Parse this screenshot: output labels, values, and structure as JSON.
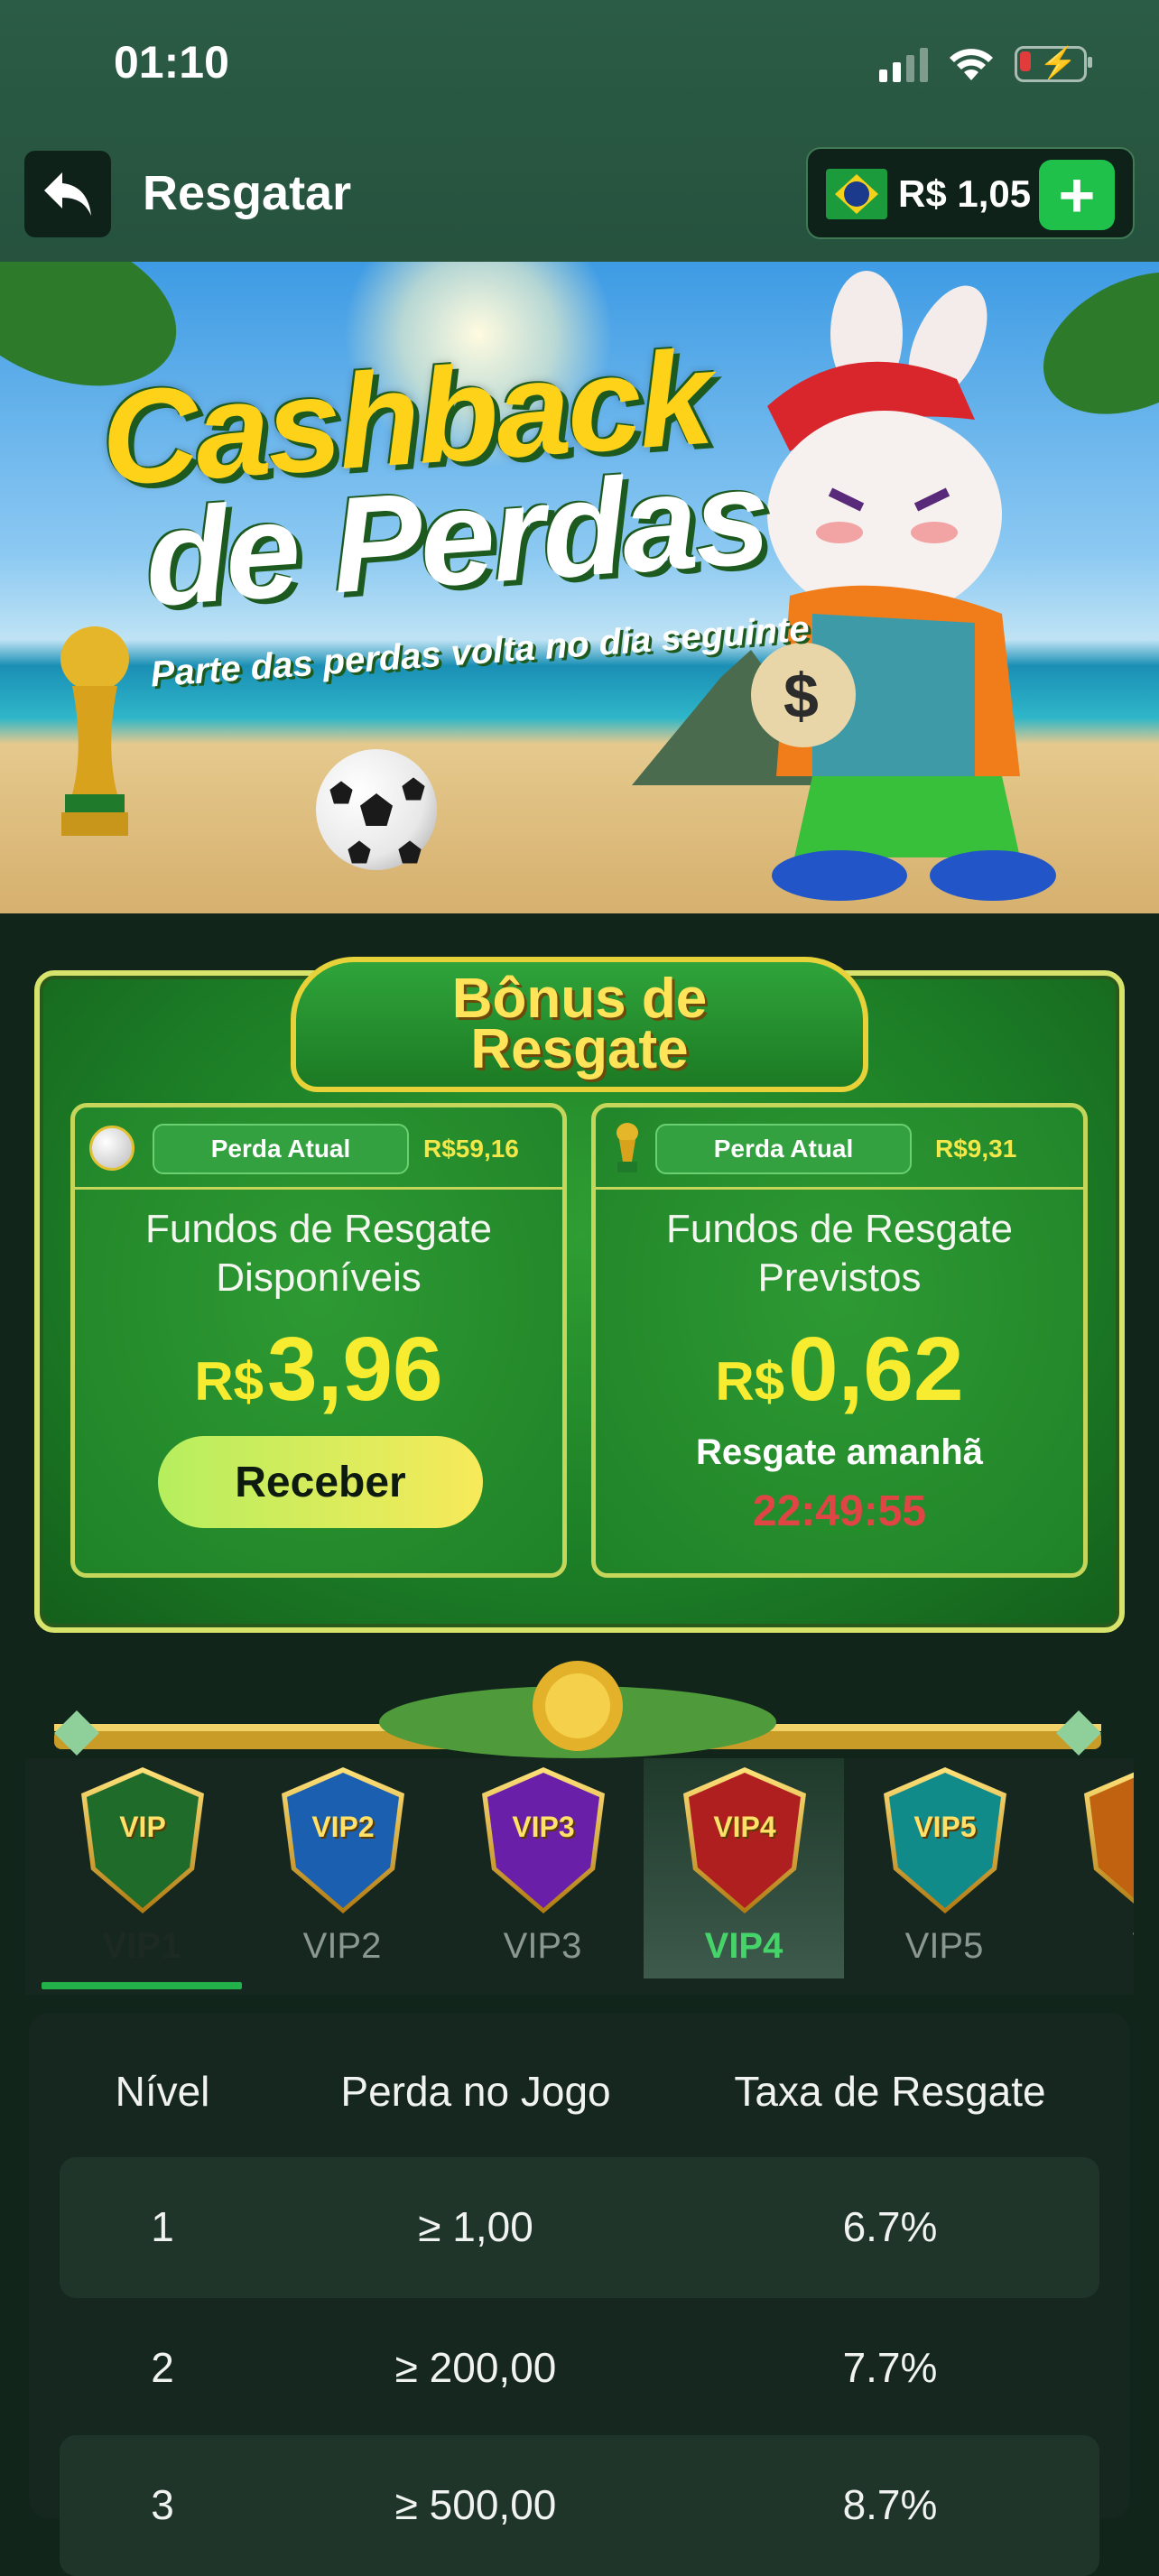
{
  "status_bar": {
    "time": "01:10"
  },
  "header": {
    "title": "Resgatar",
    "balance": "R$ 1,05",
    "add_label": "+"
  },
  "banner": {
    "title_line1": "Cashback",
    "title_line2": "de Perdas",
    "subtitle": "Parte das perdas volta no dia seguinte"
  },
  "bonus": {
    "title_line1": "Bônus de",
    "title_line2": "Resgate",
    "available": {
      "chip_label": "Perda Atual",
      "loss_amount": "R$59,16",
      "label_line1": "Fundos de Resgate",
      "label_line2": "Disponíveis",
      "currency": "R$",
      "value": "3,96",
      "button": "Receber"
    },
    "expected": {
      "chip_label": "Perda Atual",
      "loss_amount": "R$9,31",
      "label_line1": "Fundos de Resgate",
      "label_line2": "Previstos",
      "currency": "R$",
      "value": "0,62",
      "tomorrow": "Resgate amanhã",
      "countdown": "22:49:55"
    }
  },
  "vip_tabs": [
    {
      "badge": "VIP",
      "label": "VIP1",
      "color": "#1f6b2a"
    },
    {
      "badge": "VIP2",
      "label": "VIP2",
      "color": "#1a5fb0"
    },
    {
      "badge": "VIP3",
      "label": "VIP3",
      "color": "#6a1fa8"
    },
    {
      "badge": "VIP4",
      "label": "VIP4",
      "color": "#b01f1f"
    },
    {
      "badge": "VIP5",
      "label": "VIP5",
      "color": "#118a8a"
    },
    {
      "badge": "V",
      "label": "V",
      "color": "#c0620f"
    }
  ],
  "selected_vip": "VIP4",
  "table": {
    "headers": [
      "Nível",
      "Perda no Jogo",
      "Taxa de Resgate"
    ],
    "rows": [
      [
        "1",
        "≥ 1,00",
        "6.7%"
      ],
      [
        "2",
        "≥ 200,00",
        "7.7%"
      ],
      [
        "3",
        "≥ 500,00",
        "8.7%"
      ]
    ]
  }
}
